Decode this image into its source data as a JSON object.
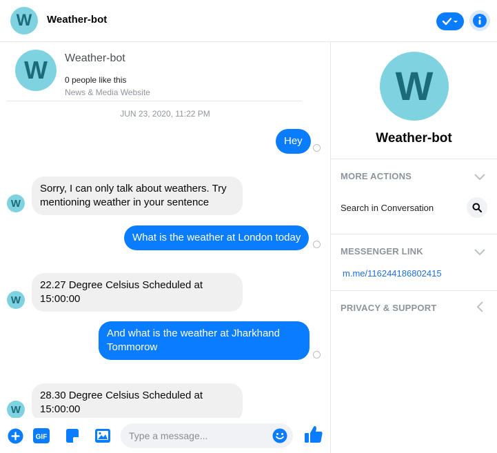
{
  "header": {
    "avatar_letter": "W",
    "title": "Weather-bot"
  },
  "page_card": {
    "avatar_letter": "W",
    "name": "Weather-bot",
    "likes": "0 people like this",
    "category": "News & Media Website"
  },
  "conversation": {
    "timestamp": "JUN 23, 2020, 11:22 PM",
    "messages": [
      {
        "from": "user",
        "text": "Hey"
      },
      {
        "from": "bot",
        "avatar_letter": "W",
        "line1": "Sorry, I can only talk about weathers. Try",
        "line2": "mentioning weather in your sentence"
      },
      {
        "from": "user",
        "text": "What is the weather at London today"
      },
      {
        "from": "bot",
        "avatar_letter": "W",
        "line1": "22.27 Degree Celsius Scheduled at",
        "line2": "15:00:00"
      },
      {
        "from": "user",
        "line1": "And what is the weather at Jharkhand",
        "line2": "Tommorow"
      },
      {
        "from": "bot",
        "avatar_letter": "W",
        "line1": "28.30 Degree Celsius Scheduled at",
        "line2": "15:00:00"
      }
    ]
  },
  "composer": {
    "placeholder": "Type a message...",
    "gif_label": "GIF",
    "icons": [
      "plus-icon",
      "gif-icon",
      "sticker-icon",
      "image-icon",
      "emoji-icon",
      "thumbs-up-icon"
    ]
  },
  "sidebar": {
    "avatar_letter": "W",
    "name": "Weather-bot",
    "sections": {
      "more_actions": "MORE ACTIONS",
      "search_in_conversation": "Search in Conversation",
      "messenger_link": "MESSENGER LINK",
      "link_url": "m.me/116244186802415",
      "privacy_support": "PRIVACY & SUPPORT"
    }
  },
  "colors": {
    "accent": "#0a7cff",
    "avatar_bg": "#7fd3e0",
    "avatar_fg": "#1d6b7a",
    "incoming_bubble": "#f0f0f0"
  }
}
